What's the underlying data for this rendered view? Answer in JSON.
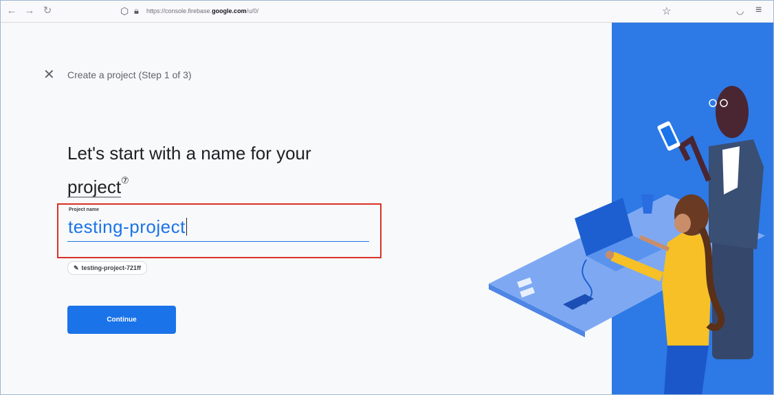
{
  "browser": {
    "url_prefix": "https://console.firebase.",
    "url_domain": "google.com",
    "url_suffix": "/u/0/",
    "back_icon": "back-arrow-icon",
    "forward_icon": "forward-arrow-icon",
    "reload_icon": "reload-icon"
  },
  "page": {
    "step_title": "Create a project (Step 1 of 3)",
    "headline_part1": "Let's start with a name for your ",
    "headline_link": "project",
    "help_icon": "?",
    "field_label": "Project name",
    "field_value": "testing-project",
    "project_id_chip": "testing-project-721ff",
    "continue_label": "Continue"
  },
  "colors": {
    "accent": "#1a73e8",
    "highlight_border": "#d93025",
    "illustration_bg": "#2d79e6"
  }
}
